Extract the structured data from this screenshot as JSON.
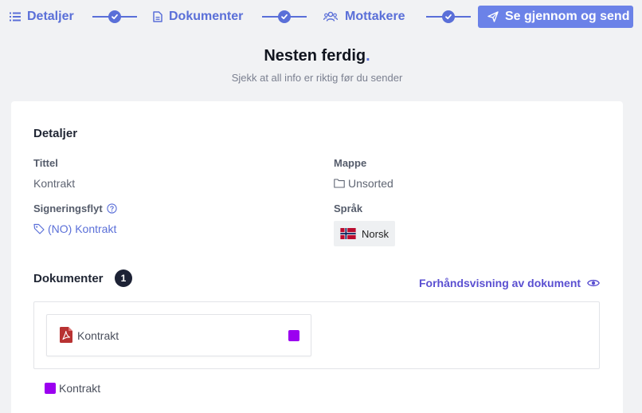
{
  "stepper": {
    "steps": [
      {
        "label": "Detaljer",
        "icon": "list-icon"
      },
      {
        "label": "Dokumenter",
        "icon": "document-icon"
      },
      {
        "label": "Mottakere",
        "icon": "users-icon"
      }
    ],
    "current": {
      "label": "Se gjennom og send",
      "icon": "send-icon"
    }
  },
  "heading": {
    "title": "Nesten ferdig",
    "title_dot": ".",
    "subtitle": "Sjekk at all info er riktig før du sender"
  },
  "details": {
    "section_title": "Detaljer",
    "title_label": "Tittel",
    "title_value": "Kontrakt",
    "folder_label": "Mappe",
    "folder_value": "Unsorted",
    "flow_label": "Signeringsflyt",
    "flow_value": "(NO) Kontrakt",
    "language_label": "Språk",
    "language_value": "Norsk"
  },
  "documents": {
    "section_title": "Dokumenter",
    "count": "1",
    "preview_label": "Forhåndsvisning av dokument",
    "items": [
      {
        "name": "Kontrakt",
        "color": "#9b00f0"
      }
    ],
    "legend": [
      {
        "name": "Kontrakt",
        "color": "#9b00f0"
      }
    ]
  },
  "colors": {
    "accent": "#5a6fd8",
    "accent_button": "#6b82e8",
    "document_color": "#9b00f0"
  }
}
